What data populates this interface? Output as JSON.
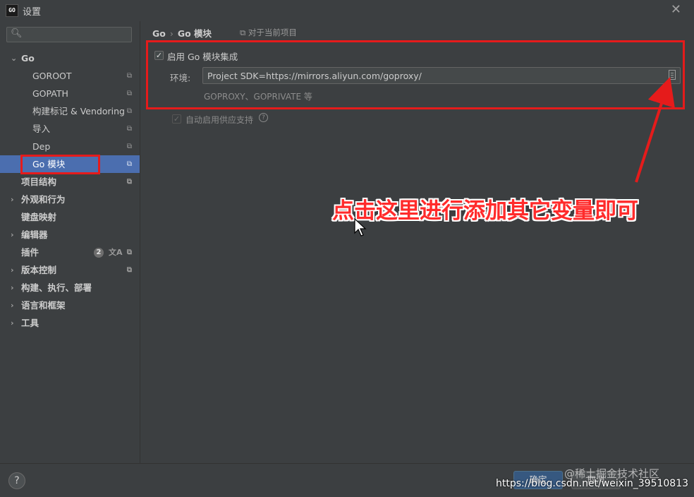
{
  "window": {
    "title": "设置",
    "app_icon_text": "GO"
  },
  "sidebar": {
    "search_placeholder": "",
    "items": [
      {
        "label": "Go",
        "bold": true,
        "expanded": true
      },
      {
        "label": "GOROOT"
      },
      {
        "label": "GOPATH"
      },
      {
        "label": "构建标记 & Vendoring"
      },
      {
        "label": "导入"
      },
      {
        "label": "Dep"
      },
      {
        "label": "Go 模块",
        "selected": true
      },
      {
        "label": "项目结构"
      },
      {
        "label": "外观和行为"
      },
      {
        "label": "键盘映射"
      },
      {
        "label": "编辑器"
      },
      {
        "label": "插件",
        "badge": "2"
      },
      {
        "label": "版本控制"
      },
      {
        "label": "构建、执行、部署"
      },
      {
        "label": "语言和框架"
      },
      {
        "label": "工具"
      }
    ]
  },
  "main": {
    "breadcrumb": {
      "parent": "Go",
      "separator": "›",
      "current": "Go 模块"
    },
    "scope_note": "对于当前项目",
    "enable_integration": {
      "label": "启用 Go 模块集成",
      "checked": true
    },
    "environment": {
      "label": "环境:",
      "value": "Project SDK=https://mirrors.aliyun.com/goproxy/",
      "hint": "GOPROXY、GOPRIVATE 等"
    },
    "vendoring": {
      "label": "自动启用供应支持",
      "checked": true,
      "disabled": true
    }
  },
  "annotation": {
    "text": "点击这里进行添加其它变量即可",
    "color": "#ff2b2b"
  },
  "footer": {
    "help": "?",
    "ok": "确定",
    "cancel": "取消"
  },
  "watermarks": {
    "top": "@稀土掘金技术社区",
    "bottom": "https://blog.csdn.net/weixin_39510813"
  },
  "colors": {
    "background": "#3c3f41",
    "selection": "#4b6eaf",
    "primary_button": "#365880",
    "annotation_red": "#e51b1b"
  }
}
